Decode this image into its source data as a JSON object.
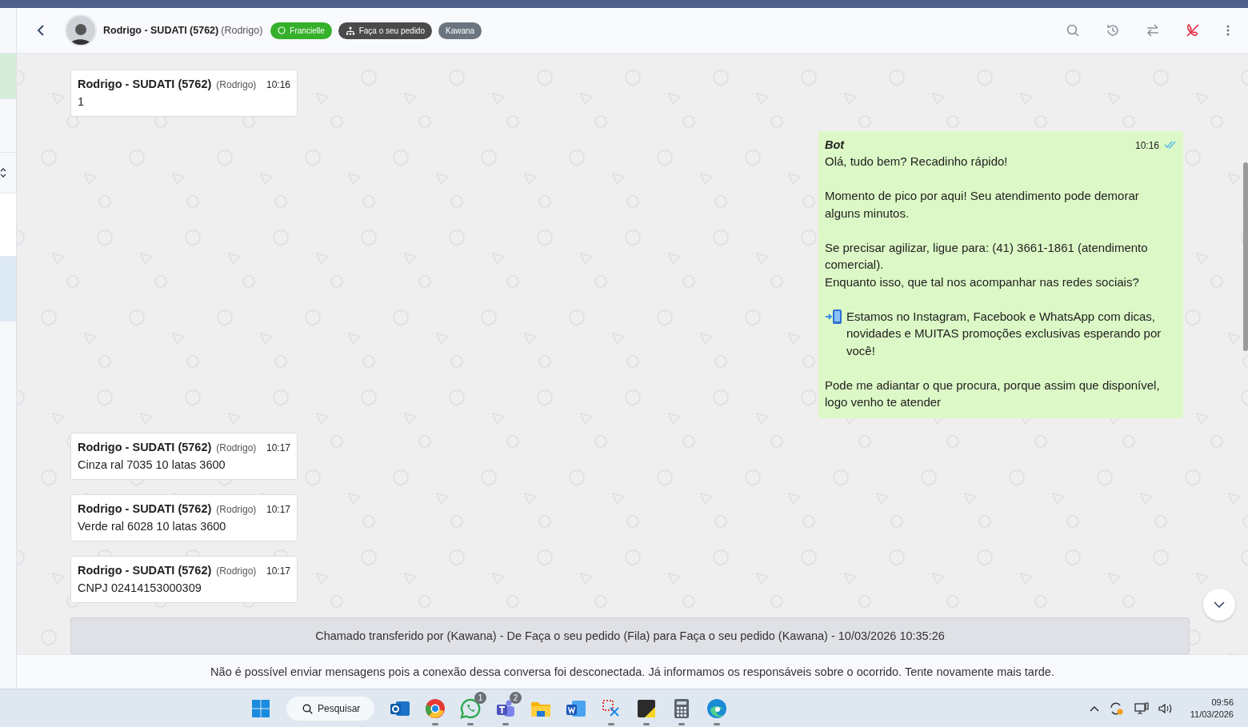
{
  "header": {
    "name": "Rodrigo - SUDATI (5762)",
    "nickname": "(Rodrigo)",
    "tags": [
      {
        "label": "Francielle",
        "kind": "whatsapp",
        "color": "#35b02a"
      },
      {
        "label": "Faça o seu pedido",
        "kind": "queue",
        "color": "#4a4a4a"
      },
      {
        "label": "Kawana",
        "kind": "plain",
        "color": "#6b7580"
      }
    ]
  },
  "messages": [
    {
      "kind": "incoming",
      "sender": "Rodrigo - SUDATI (5762)",
      "nickname": "(Rodrigo)",
      "time": "10:16",
      "text": "1"
    },
    {
      "kind": "outgoing",
      "sender": "Bot",
      "time": "10:16",
      "read": true,
      "paragraphs": [
        {
          "lines": [
            "Olá, tudo bem? Recadinho rápido!"
          ]
        },
        {
          "lines": [
            "Momento de pico por aqui! Seu atendimento pode demorar alguns minutos."
          ]
        },
        {
          "lines": [
            "Se precisar agilizar, ligue para: (41) 3661-1861 (atendimento comercial).",
            "Enquanto isso, que tal nos acompanhar nas redes sociais?"
          ]
        },
        {
          "kind": "phone",
          "lines": [
            "Estamos no Instagram, Facebook e WhatsApp com dicas, novidades e MUITAS promoções exclusivas esperando por você!"
          ]
        },
        {
          "lines": [
            "Pode me adiantar o que procura, porque assim que disponível, logo venho te atender"
          ]
        }
      ]
    },
    {
      "kind": "incoming",
      "sender": "Rodrigo - SUDATI (5762)",
      "nickname": "(Rodrigo)",
      "time": "10:17",
      "text": "Cinza ral 7035 10 latas 3600"
    },
    {
      "kind": "incoming",
      "sender": "Rodrigo - SUDATI (5762)",
      "nickname": "(Rodrigo)",
      "time": "10:17",
      "text": "Verde ral 6028 10 latas 3600"
    },
    {
      "kind": "incoming",
      "sender": "Rodrigo - SUDATI (5762)",
      "nickname": "(Rodrigo)",
      "time": "10:17",
      "text": "CNPJ 02414153000309"
    },
    {
      "kind": "system",
      "text": "Chamado transferido por (Kawana) - De Faça o seu pedido (Fila) para Faça o seu pedido (Kawana) - 10/03/2026 10:35:26"
    }
  ],
  "notice": "Não é possível enviar mensagens pois a conexão dessa conversa foi desconectada. Já informamos os responsáveis sobre o ocorrido. Tente novamente mais tarde.",
  "taskbar": {
    "search": "Pesquisar",
    "apps": [
      {
        "kind": "outlook",
        "running": false
      },
      {
        "kind": "chrome",
        "running": true
      },
      {
        "kind": "whatsapp",
        "running": true,
        "badge": "1"
      },
      {
        "kind": "teams",
        "running": true,
        "badge": "2"
      },
      {
        "kind": "folder",
        "running": false
      },
      {
        "kind": "word",
        "running": false
      },
      {
        "kind": "snip",
        "running": true
      },
      {
        "kind": "notes",
        "running": true
      },
      {
        "kind": "calc",
        "running": true
      },
      {
        "kind": "edge",
        "running": true
      }
    ],
    "time": "09:56",
    "date": "11/03/2026"
  }
}
